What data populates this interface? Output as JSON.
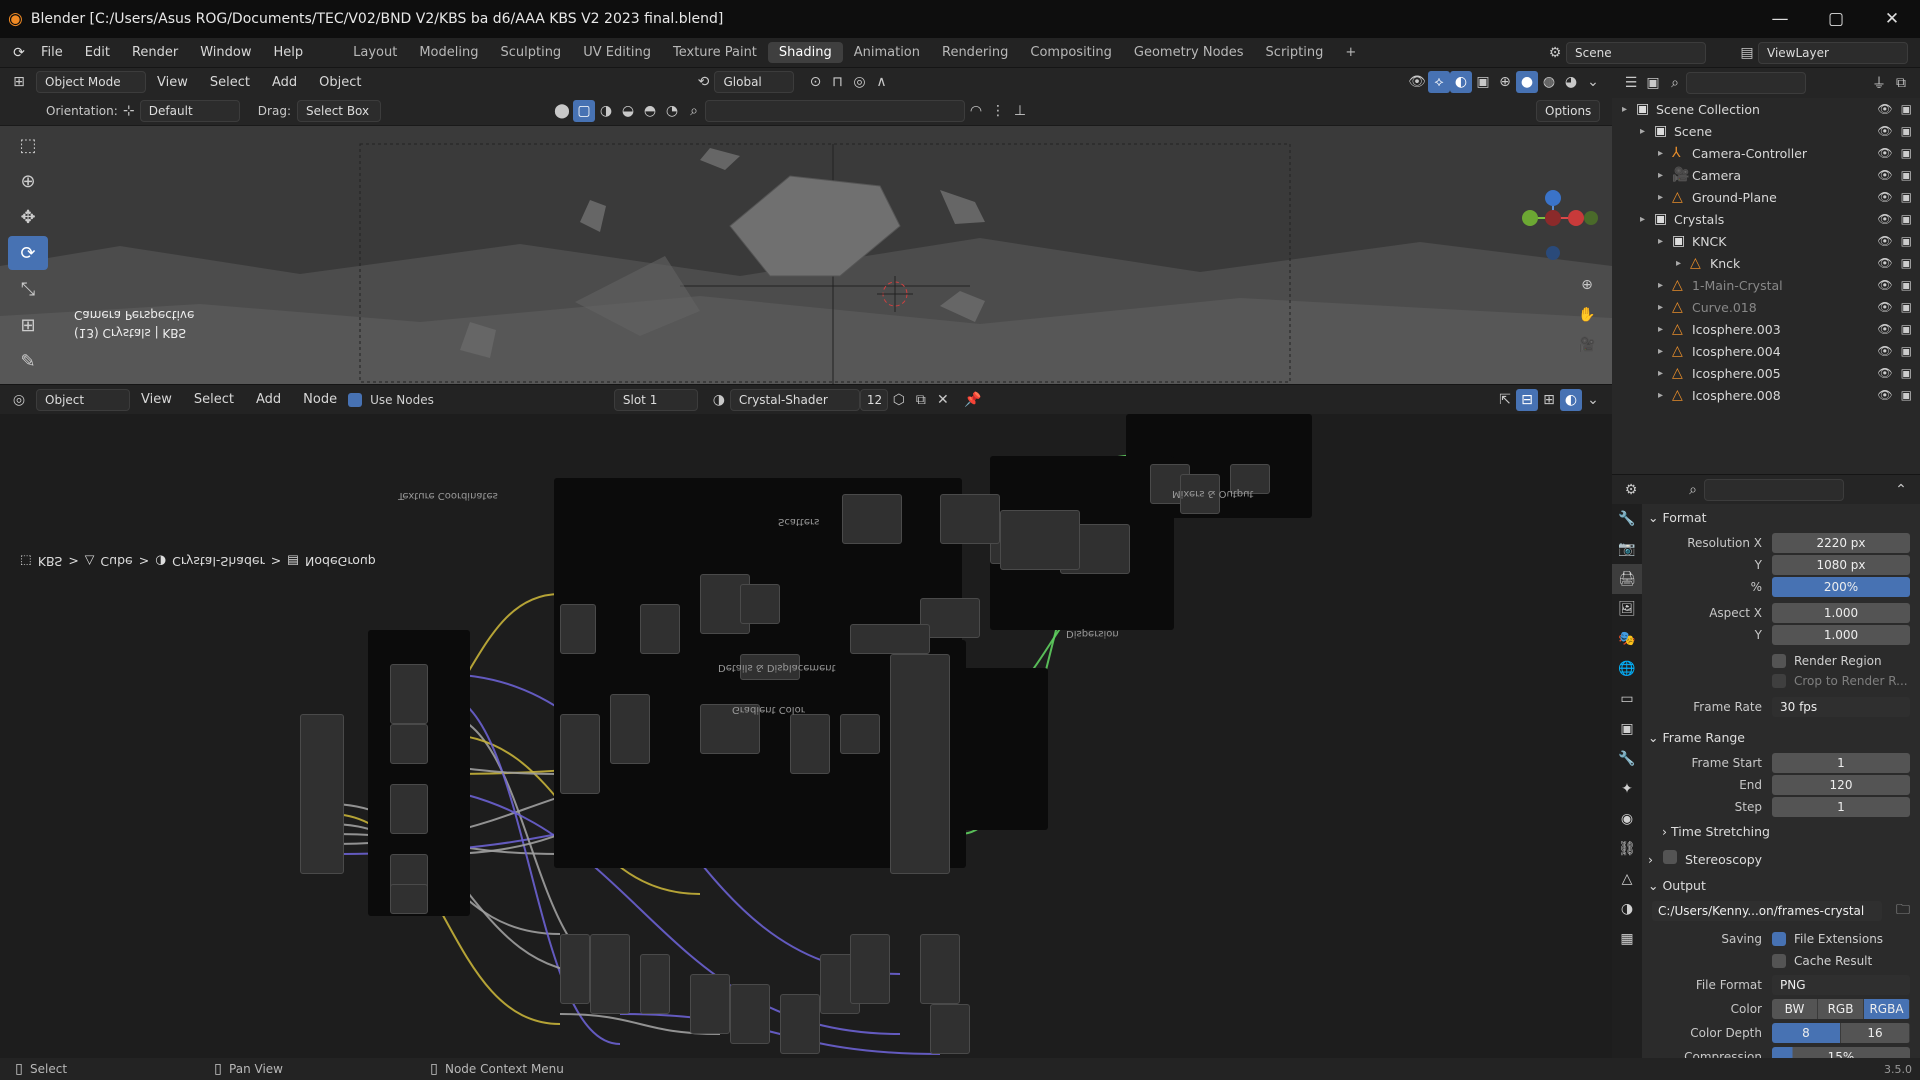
{
  "window": {
    "title": "Blender [C:/Users/Asus ROG/Documents/TEC/V02/BND V2/KBS ba d6/AAA KBS V2 2023 final.blend]",
    "minimize": "—",
    "maximize": "▢",
    "close": "✕"
  },
  "menubar": {
    "items": [
      "File",
      "Edit",
      "Render",
      "Window",
      "Help"
    ],
    "workspaces": [
      "Layout",
      "Modeling",
      "Sculpting",
      "UV Editing",
      "Texture Paint",
      "Shading",
      "Animation",
      "Rendering",
      "Compositing",
      "Geometry Nodes",
      "Scripting"
    ],
    "active_workspace": "Shading",
    "add_workspace": "+",
    "scene": "Scene",
    "view_layer": "ViewLayer"
  },
  "viewport": {
    "mode": "Object Mode",
    "menus": [
      "View",
      "Select",
      "Add",
      "Object"
    ],
    "transform_orientation": "Global",
    "orientation_label": "Orientation:",
    "orientation_value": "Default",
    "drag_label": "Drag:",
    "drag_value": "Select Box",
    "options_label": "Options",
    "overlay_line1": "Camera Perspective",
    "overlay_line2": "(13) Crystals | KBS"
  },
  "node_editor": {
    "mode": "Object",
    "menus": [
      "View",
      "Select",
      "Add",
      "Node"
    ],
    "use_nodes_label": "Use Nodes",
    "slot": "Slot 1",
    "material": "Crystal-Shader",
    "user_count": "12",
    "breadcrumb": [
      "KBS",
      "Cube",
      "Crystal-Shader",
      "NodeGroup"
    ],
    "frames": [
      "Gradient Color",
      "Scatters",
      "Mixers & Output",
      "Dispersion",
      "Details & Displacement",
      "Texture Coordinates"
    ]
  },
  "outliner": {
    "search_placeholder": "",
    "rows": [
      {
        "indent": 0,
        "name": "Scene Collection",
        "icon": "collection-icon"
      },
      {
        "indent": 1,
        "name": "Scene",
        "icon": "collection-icon"
      },
      {
        "indent": 2,
        "name": "Camera-Controller",
        "icon": "empty-icon"
      },
      {
        "indent": 2,
        "name": "Camera",
        "icon": "camera-icon"
      },
      {
        "indent": 2,
        "name": "Ground-Plane",
        "icon": "mesh-icon"
      },
      {
        "indent": 1,
        "name": "Crystals",
        "icon": "collection-icon"
      },
      {
        "indent": 2,
        "name": "KNCK",
        "icon": "collection-icon"
      },
      {
        "indent": 3,
        "name": "Knck",
        "icon": "mesh-icon"
      },
      {
        "indent": 2,
        "name": "1-Main-Crystal",
        "icon": "mesh-icon",
        "dim": true
      },
      {
        "indent": 2,
        "name": "Curve.018",
        "icon": "curve-icon",
        "dim": true
      },
      {
        "indent": 2,
        "name": "Icosphere.003",
        "icon": "mesh-icon"
      },
      {
        "indent": 2,
        "name": "Icosphere.004",
        "icon": "mesh-icon"
      },
      {
        "indent": 2,
        "name": "Icosphere.005",
        "icon": "mesh-icon"
      },
      {
        "indent": 2,
        "name": "Icosphere.008",
        "icon": "mesh-icon"
      }
    ]
  },
  "properties": {
    "format_header": "Format",
    "resolution_x_label": "Resolution X",
    "resolution_x": "2220 px",
    "resolution_y_label": "Y",
    "resolution_y": "1080 px",
    "percent_label": "%",
    "percent": "200%",
    "aspect_x_label": "Aspect X",
    "aspect_x": "1.000",
    "aspect_y_label": "Y",
    "aspect_y": "1.000",
    "render_region_label": "Render Region",
    "crop_label": "Crop to Render R...",
    "frame_rate_label": "Frame Rate",
    "frame_rate": "30 fps",
    "frame_range_header": "Frame Range",
    "frame_start_label": "Frame Start",
    "frame_start": "1",
    "end_label": "End",
    "end": "120",
    "step_label": "Step",
    "step": "1",
    "time_stretching": "Time Stretching",
    "stereoscopy": "Stereoscopy",
    "output_header": "Output",
    "output_path": "C:/Users/Kenny...on/frames-crystal",
    "saving_label": "Saving",
    "file_extensions": "File Extensions",
    "cache_result": "Cache Result",
    "file_format_label": "File Format",
    "file_format": "PNG",
    "color_label": "Color",
    "color_options": [
      "BW",
      "RGB",
      "RGBA"
    ],
    "color_active": "RGBA",
    "color_depth_label": "Color Depth",
    "color_depth_options": [
      "8",
      "16"
    ],
    "color_depth_active": "8",
    "compression_label": "Compression",
    "compression": "15%"
  },
  "statusbar": {
    "items": [
      "Select",
      "Pan View",
      "Node Context Menu"
    ],
    "version": "3.5.0"
  },
  "colors": {
    "accent": "#4772b3",
    "brand": "#f08a24",
    "wire_gray": "#a0a0a0",
    "wire_yellow": "#c7b33a",
    "wire_purple": "#6b62d1",
    "wire_green": "#5fcf5f"
  }
}
